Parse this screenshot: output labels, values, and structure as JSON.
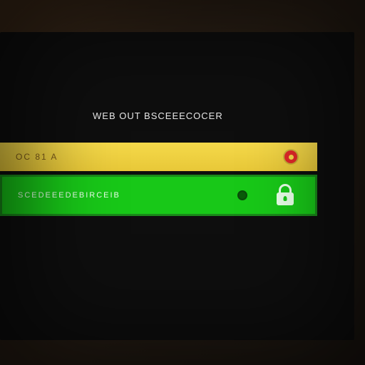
{
  "title": "WEB OUT BSCEEECOCER",
  "option_yellow": {
    "label": "OC 81 A",
    "color_bg": "#f5d94a",
    "status": "unselected"
  },
  "option_green": {
    "label": "SCEDEEEDEBIRCEIB",
    "color_bg": "#18c818",
    "status": "selected",
    "icon": "lock-icon"
  }
}
